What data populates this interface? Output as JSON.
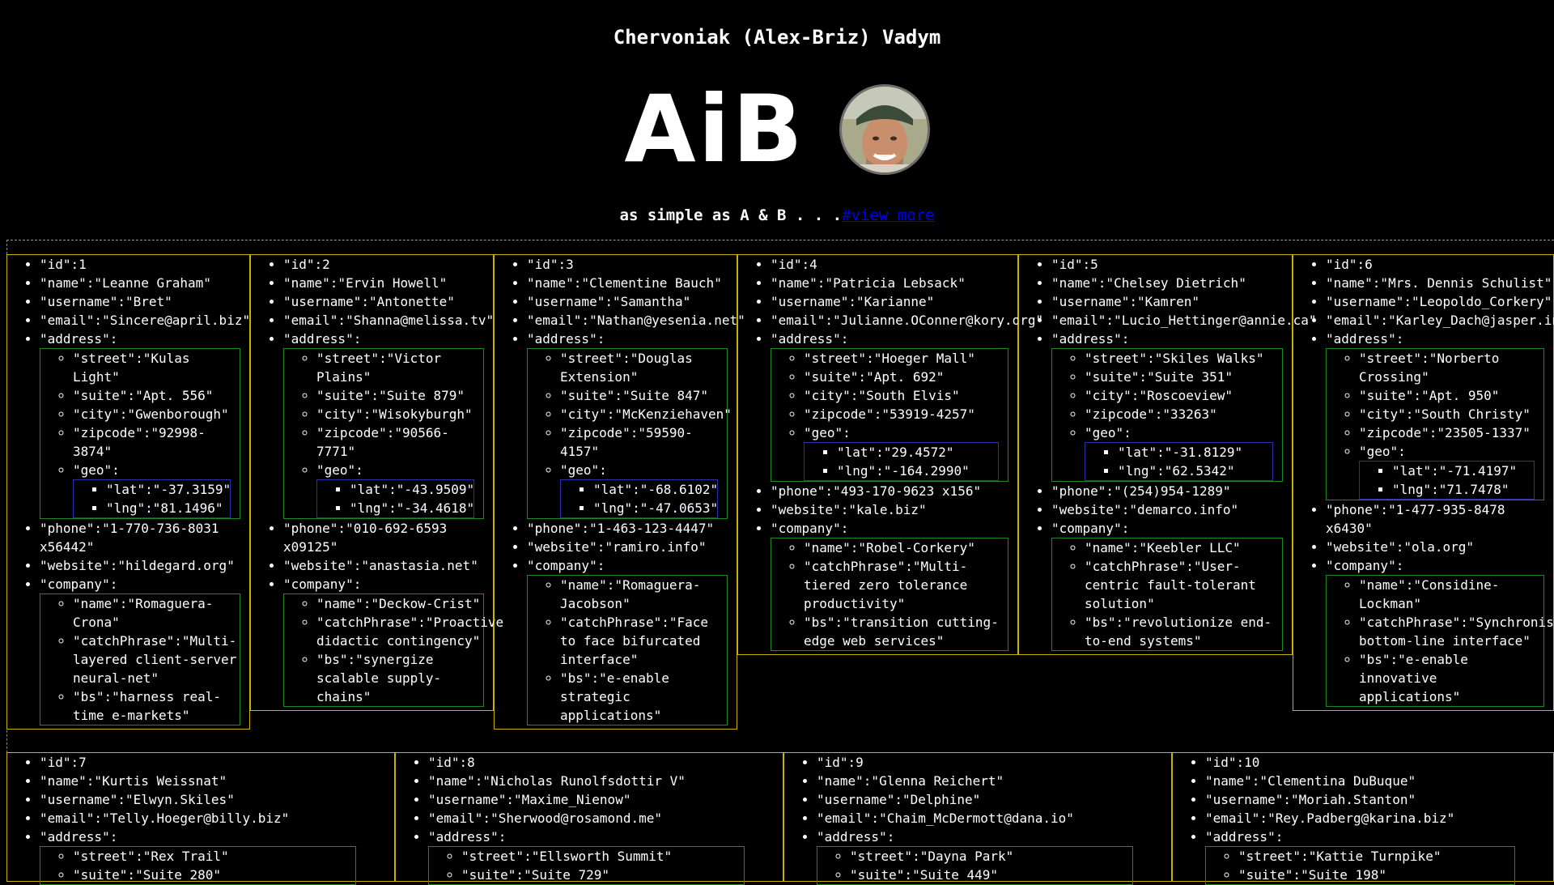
{
  "header": {
    "name": "Chervoniak (Alex-Briz) Vadym",
    "logo": "AiB",
    "tagline_prefix": "as simple as A & B . . .",
    "tagline_link": "#view more"
  },
  "avatar": {
    "icon": "avatar-photo",
    "alt": "profile photo"
  },
  "users": [
    {
      "id": "\"id\":1",
      "name": "\"name\":\"Leanne Graham\"",
      "username": "\"username\":\"Bret\"",
      "email": "\"email\":\"Sincere@april.biz\"",
      "address_label": "\"address\":",
      "street": "\"street\":\"Kulas Light\"",
      "suite": "\"suite\":\"Apt. 556\"",
      "city": "\"city\":\"Gwenborough\"",
      "zipcode": "\"zipcode\":\"92998-3874\"",
      "geo_label": "\"geo\":",
      "lat": "\"lat\":\"-37.3159\"",
      "lng": "\"lng\":\"81.1496\"",
      "phone": "\"phone\":\"1-770-736-8031 x56442\"",
      "website": "\"website\":\"hildegard.org\"",
      "company_label": "\"company\":",
      "company_name": "\"name\":\"Romaguera-Crona\"",
      "catchPhrase": "\"catchPhrase\":\"Multi-layered client-server neural-net\"",
      "bs": "\"bs\":\"harness real-time e-markets\""
    },
    {
      "id": "\"id\":2",
      "name": "\"name\":\"Ervin Howell\"",
      "username": "\"username\":\"Antonette\"",
      "email": "\"email\":\"Shanna@melissa.tv\"",
      "address_label": "\"address\":",
      "street": "\"street\":\"Victor Plains\"",
      "suite": "\"suite\":\"Suite 879\"",
      "city": "\"city\":\"Wisokyburgh\"",
      "zipcode": "\"zipcode\":\"90566-7771\"",
      "geo_label": "\"geo\":",
      "lat": "\"lat\":\"-43.9509\"",
      "lng": "\"lng\":\"-34.4618\"",
      "phone": "\"phone\":\"010-692-6593 x09125\"",
      "website": "\"website\":\"anastasia.net\"",
      "company_label": "\"company\":",
      "company_name": "\"name\":\"Deckow-Crist\"",
      "catchPhrase": "\"catchPhrase\":\"Proactive didactic contingency\"",
      "bs": "\"bs\":\"synergize scalable supply-chains\""
    },
    {
      "id": "\"id\":3",
      "name": "\"name\":\"Clementine Bauch\"",
      "username": "\"username\":\"Samantha\"",
      "email": "\"email\":\"Nathan@yesenia.net\"",
      "address_label": "\"address\":",
      "street": "\"street\":\"Douglas Extension\"",
      "suite": "\"suite\":\"Suite 847\"",
      "city": "\"city\":\"McKenziehaven\"",
      "zipcode": "\"zipcode\":\"59590-4157\"",
      "geo_label": "\"geo\":",
      "lat": "\"lat\":\"-68.6102\"",
      "lng": "\"lng\":\"-47.0653\"",
      "phone": "\"phone\":\"1-463-123-4447\"",
      "website": "\"website\":\"ramiro.info\"",
      "company_label": "\"company\":",
      "company_name": "\"name\":\"Romaguera-Jacobson\"",
      "catchPhrase": "\"catchPhrase\":\"Face to face bifurcated interface\"",
      "bs": "\"bs\":\"e-enable strategic applications\""
    },
    {
      "id": "\"id\":4",
      "name": "\"name\":\"Patricia Lebsack\"",
      "username": "\"username\":\"Karianne\"",
      "email": "\"email\":\"Julianne.OConner@kory.org\"",
      "address_label": "\"address\":",
      "street": "\"street\":\"Hoeger Mall\"",
      "suite": "\"suite\":\"Apt. 692\"",
      "city": "\"city\":\"South Elvis\"",
      "zipcode": "\"zipcode\":\"53919-4257\"",
      "geo_label": "\"geo\":",
      "lat": "\"lat\":\"29.4572\"",
      "lng": "\"lng\":\"-164.2990\"",
      "phone": "\"phone\":\"493-170-9623 x156\"",
      "website": "\"website\":\"kale.biz\"",
      "company_label": "\"company\":",
      "company_name": "\"name\":\"Robel-Corkery\"",
      "catchPhrase": "\"catchPhrase\":\"Multi-tiered zero tolerance productivity\"",
      "bs": "\"bs\":\"transition cutting-edge web services\""
    },
    {
      "id": "\"id\":5",
      "name": "\"name\":\"Chelsey Dietrich\"",
      "username": "\"username\":\"Kamren\"",
      "email": "\"email\":\"Lucio_Hettinger@annie.ca\"",
      "address_label": "\"address\":",
      "street": "\"street\":\"Skiles Walks\"",
      "suite": "\"suite\":\"Suite 351\"",
      "city": "\"city\":\"Roscoeview\"",
      "zipcode": "\"zipcode\":\"33263\"",
      "geo_label": "\"geo\":",
      "lat": "\"lat\":\"-31.8129\"",
      "lng": "\"lng\":\"62.5342\"",
      "phone": "\"phone\":\"(254)954-1289\"",
      "website": "\"website\":\"demarco.info\"",
      "company_label": "\"company\":",
      "company_name": "\"name\":\"Keebler LLC\"",
      "catchPhrase": "\"catchPhrase\":\"User-centric fault-tolerant solution\"",
      "bs": "\"bs\":\"revolutionize end-to-end systems\""
    },
    {
      "id": "\"id\":6",
      "name": "\"name\":\"Mrs. Dennis Schulist\"",
      "username": "\"username\":\"Leopoldo_Corkery\"",
      "email": "\"email\":\"Karley_Dach@jasper.info\"",
      "address_label": "\"address\":",
      "street": "\"street\":\"Norberto Crossing\"",
      "suite": "\"suite\":\"Apt. 950\"",
      "city": "\"city\":\"South Christy\"",
      "zipcode": "\"zipcode\":\"23505-1337\"",
      "geo_label": "\"geo\":",
      "lat": "\"lat\":\"-71.4197\"",
      "lng": "\"lng\":\"71.7478\"",
      "phone": "\"phone\":\"1-477-935-8478 x6430\"",
      "website": "\"website\":\"ola.org\"",
      "company_label": "\"company\":",
      "company_name": "\"name\":\"Considine-Lockman\"",
      "catchPhrase": "\"catchPhrase\":\"Synchronised bottom-line interface\"",
      "bs": "\"bs\":\"e-enable innovative applications\""
    },
    {
      "id": "\"id\":7",
      "name": "\"name\":\"Kurtis Weissnat\"",
      "username": "\"username\":\"Elwyn.Skiles\"",
      "email": "\"email\":\"Telly.Hoeger@billy.biz\"",
      "address_label": "\"address\":",
      "street": "\"street\":\"Rex Trail\"",
      "suite": "\"suite\":\"Suite 280\""
    },
    {
      "id": "\"id\":8",
      "name": "\"name\":\"Nicholas Runolfsdottir V\"",
      "username": "\"username\":\"Maxime_Nienow\"",
      "email": "\"email\":\"Sherwood@rosamond.me\"",
      "address_label": "\"address\":",
      "street": "\"street\":\"Ellsworth Summit\"",
      "suite": "\"suite\":\"Suite 729\""
    },
    {
      "id": "\"id\":9",
      "name": "\"name\":\"Glenna Reichert\"",
      "username": "\"username\":\"Delphine\"",
      "email": "\"email\":\"Chaim_McDermott@dana.io\"",
      "address_label": "\"address\":",
      "street": "\"street\":\"Dayna Park\"",
      "suite": "\"suite\":\"Suite 449\""
    },
    {
      "id": "\"id\":10",
      "name": "\"name\":\"Clementina DuBuque\"",
      "username": "\"username\":\"Moriah.Stanton\"",
      "email": "\"email\":\"Rey.Padberg@karina.biz\"",
      "address_label": "\"address\":",
      "street": "\"street\":\"Kattie Turnpike\"",
      "suite": "\"suite\":\"Suite 198\""
    }
  ]
}
